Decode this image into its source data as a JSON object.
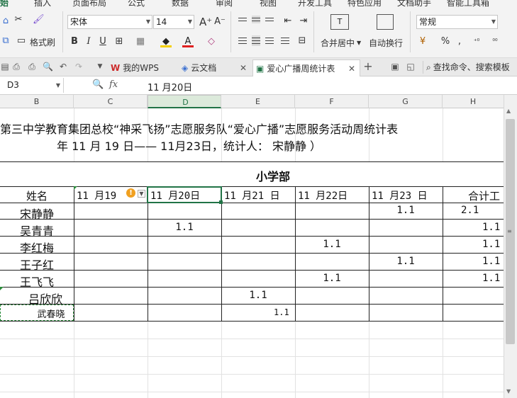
{
  "menu": [
    "始",
    "插入",
    "页面布局",
    "公式",
    "数据",
    "审阅",
    "视图",
    "开发工具",
    "特色应用",
    "文档助手",
    "智能工具箱"
  ],
  "ribbon": {
    "cut_label": "",
    "format_painter_label": "格式刷",
    "font_name": "宋体",
    "font_size": "14",
    "merge_label": "合并居中",
    "wrap_label": "自动换行",
    "number_format": "常规",
    "percent": "%",
    "comma": ","
  },
  "tabs": [
    {
      "label": "我的WPS"
    },
    {
      "label": "云文档"
    },
    {
      "label": "爱心广播周统计表"
    }
  ],
  "search_placeholder": "查找命令、搜索模板",
  "formula_bar": {
    "name_box": "D3",
    "fx": "fx",
    "content": "11 月20日"
  },
  "columns": [
    "B",
    "C",
    "D",
    "E",
    "F",
    "G",
    "H"
  ],
  "sheet": {
    "title_line1": "第三中学教育集团总校“神采飞扬”志愿服务队“爱心广播”志愿服务活动周统计表",
    "title_line2": "年 11  月 19  日——     11月23日，统计人：  宋静静         ）",
    "section": "小学部",
    "headers": [
      "姓名",
      "11 月19",
      "11 月20日",
      "11 月21 日",
      "11 月22日",
      "11 月23 日",
      "合计工"
    ],
    "rows": [
      {
        "name": "宋静静",
        "c": "",
        "d": "",
        "e": "",
        "f": "",
        "g": "1.1",
        "h": "2.1"
      },
      {
        "name": "吴青青",
        "c": "",
        "d": "1.1",
        "e": "",
        "f": "",
        "g": "",
        "h": "1.1"
      },
      {
        "name": "李红梅",
        "c": "",
        "d": "",
        "e": "",
        "f": "1.1",
        "g": "",
        "h": "1.1"
      },
      {
        "name": "王子红",
        "c": "",
        "d": "",
        "e": "",
        "f": "",
        "g": "1.1",
        "h": "1.1"
      },
      {
        "name": "王飞飞",
        "c": "",
        "d": "",
        "e": "",
        "f": "1.1",
        "g": "",
        "h": "1.1"
      },
      {
        "name": "吕欣欣",
        "c": "",
        "d": "",
        "e": "1.1",
        "f": "",
        "g": "",
        "h": ""
      },
      {
        "name": "武春晓",
        "c": "",
        "d": "",
        "e": "1.1",
        "f": "",
        "g": "",
        "h": ""
      }
    ]
  },
  "colors": {
    "accent": "#217346",
    "warn": "#f0a020",
    "tab_icon": "#cc2b2b"
  }
}
